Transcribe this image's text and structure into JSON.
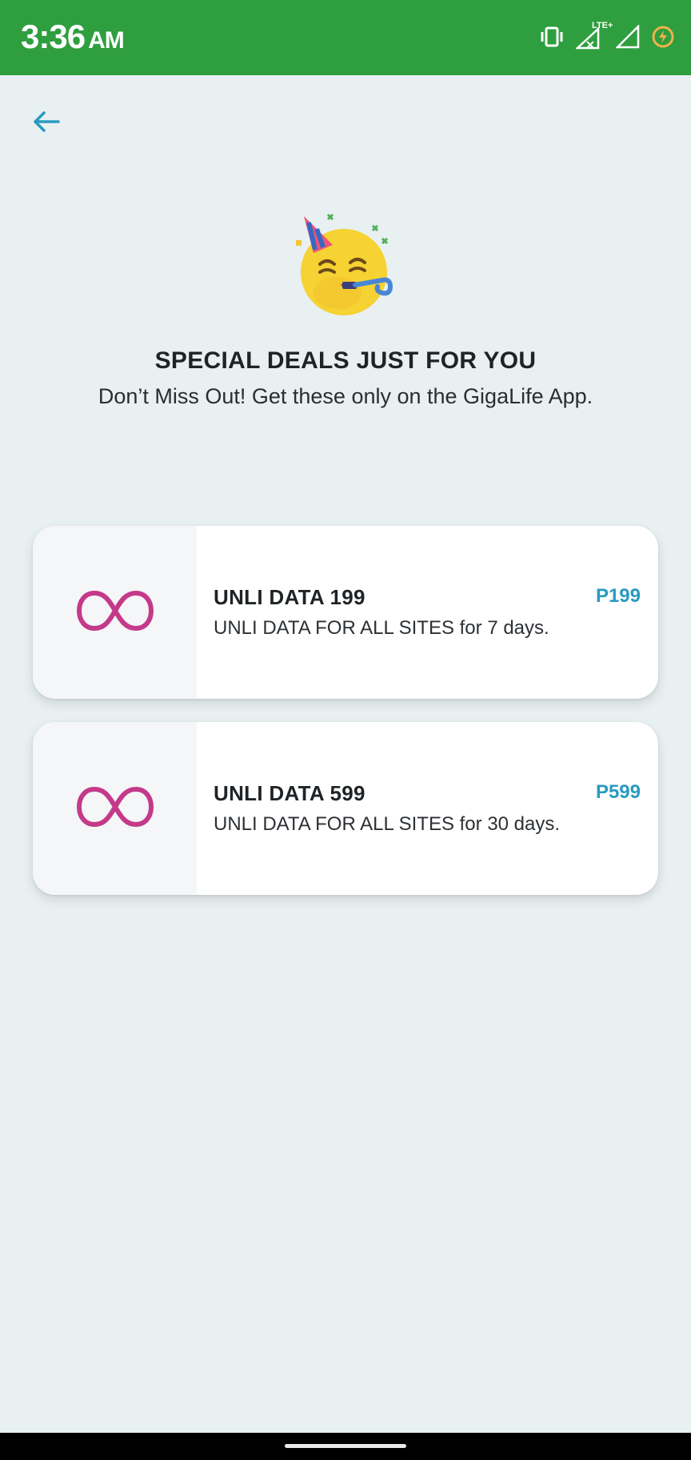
{
  "status_bar": {
    "time": "3:36",
    "ampm": "AM",
    "icons": [
      "vibrate-icon",
      "signal-lte-icon",
      "signal-icon",
      "battery-saver-icon"
    ],
    "network_label": "LTE+"
  },
  "header": {
    "back_icon": "arrow-left-icon"
  },
  "hero": {
    "emoji": "party-face-icon",
    "title": "SPECIAL DEALS JUST FOR YOU",
    "subtitle": "Don’t Miss Out! Get these only on the GigaLife App."
  },
  "deals": [
    {
      "title": "UNLI DATA 199",
      "description": "UNLI DATA FOR ALL SITES for 7 days.",
      "price": "P199",
      "icon": "infinity-icon"
    },
    {
      "title": "UNLI DATA 599",
      "description": "UNLI DATA FOR ALL SITES for 30 days.",
      "price": "P599",
      "icon": "infinity-icon"
    }
  ],
  "colors": {
    "status_bar": "#2f9e3f",
    "background": "#e8f0f1",
    "accent_blue": "#2a9ac0",
    "infinity_magenta": "#c43a8a"
  }
}
